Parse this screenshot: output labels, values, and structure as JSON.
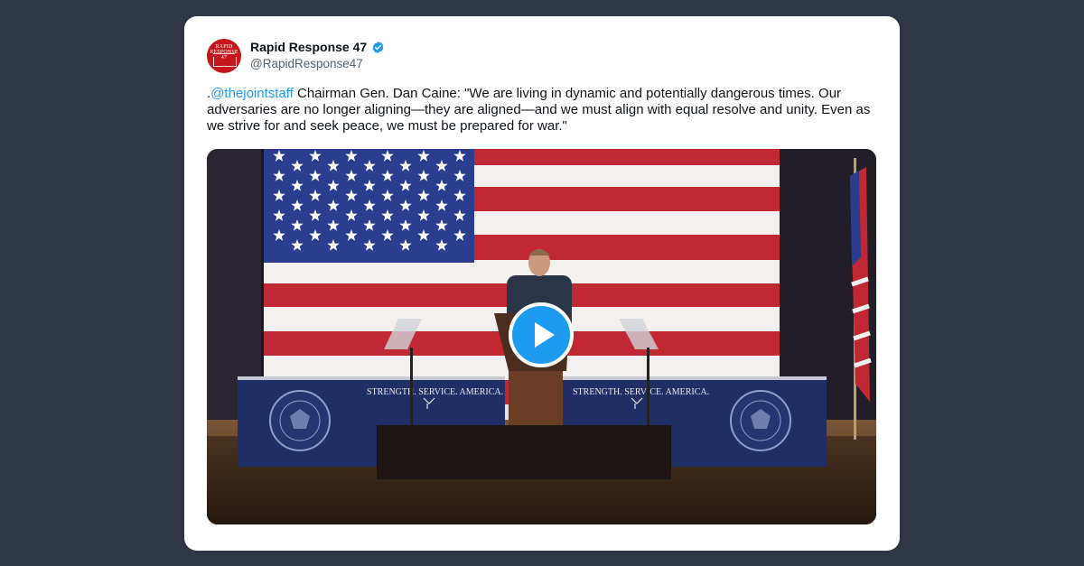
{
  "tweet": {
    "display_name": "Rapid Response 47",
    "handle": "@RapidResponse47",
    "text_prefix": ".",
    "mention": "@thejointstaff",
    "text_body": " Chairman Gen. Dan Caine: \"We are living in dynamic and potentially dangerous times. Our adversaries are no longer aligning—they are aligned—and we must align with equal resolve and unity. Even as we strive for and seek peace, we must be prepared for war.\""
  },
  "avatar": {
    "logo_text": [
      "RAPID",
      "RESPONSE",
      "47"
    ]
  },
  "video": {
    "banner_left": "STRENGTH. SERVICE. AMERICA.",
    "banner_right": "STRENGTH. SERVICE. AMERICA.",
    "seal_text": "PRESIDENT OF THE UNITED STATES"
  },
  "colors": {
    "background": "#2f3747",
    "card": "#ffffff",
    "accent": "#1d9bf0",
    "brand_red": "#c4161c"
  },
  "icons": [
    "verified-badge-icon",
    "play-icon"
  ]
}
